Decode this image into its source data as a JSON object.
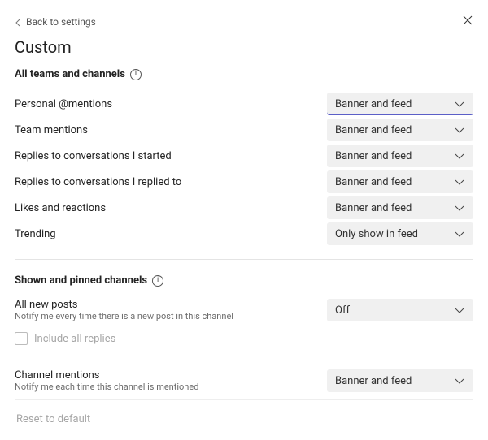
{
  "nav": {
    "back_label": "Back to settings"
  },
  "title": "Custom",
  "section1": {
    "heading": "All teams and channels",
    "rows": [
      {
        "label": "Personal @mentions",
        "value": "Banner and feed",
        "active": true
      },
      {
        "label": "Team mentions",
        "value": "Banner and feed"
      },
      {
        "label": "Replies to conversations I started",
        "value": "Banner and feed"
      },
      {
        "label": "Replies to conversations I replied to",
        "value": "Banner and feed"
      },
      {
        "label": "Likes and reactions",
        "value": "Banner and feed"
      },
      {
        "label": "Trending",
        "value": "Only show in feed"
      }
    ]
  },
  "section2": {
    "heading": "Shown and pinned channels",
    "rows": [
      {
        "label": "All new posts",
        "sub": "Notify me every time there is a new post in this channel",
        "value": "Off"
      }
    ],
    "include_replies_label": "Include all replies",
    "rows2": [
      {
        "label": "Channel mentions",
        "sub": "Notify me each time this channel is mentioned",
        "value": "Banner and feed"
      }
    ]
  },
  "reset_label": "Reset to default"
}
